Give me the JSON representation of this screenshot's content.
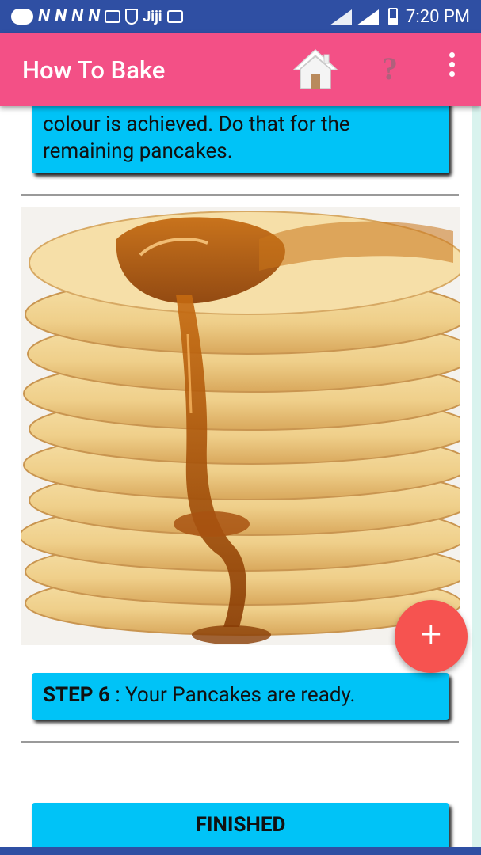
{
  "status_bar": {
    "left_icons": [
      "N",
      "N",
      "N",
      "N"
    ],
    "jiji_label": "Jiji",
    "time": "7:20 PM"
  },
  "app_bar": {
    "title": "How To Bake",
    "help_glyph": "?",
    "accent_color": "#f35086",
    "icons": [
      "home-icon",
      "help-icon",
      "more-vert-icon"
    ]
  },
  "steps": {
    "previous_text": "colour is achieved. Do that for the remaining pancakes.",
    "step6_label": "STEP 6",
    "step6_separator": " : ",
    "step6_text": "Your Pancakes are ready.",
    "card_color": "#00c3f7"
  },
  "image": {
    "subject": "stack of pancakes with syrup"
  },
  "finish_button": {
    "label": "FINISHED"
  },
  "fab": {
    "glyph": "+",
    "color": "#f65350"
  }
}
